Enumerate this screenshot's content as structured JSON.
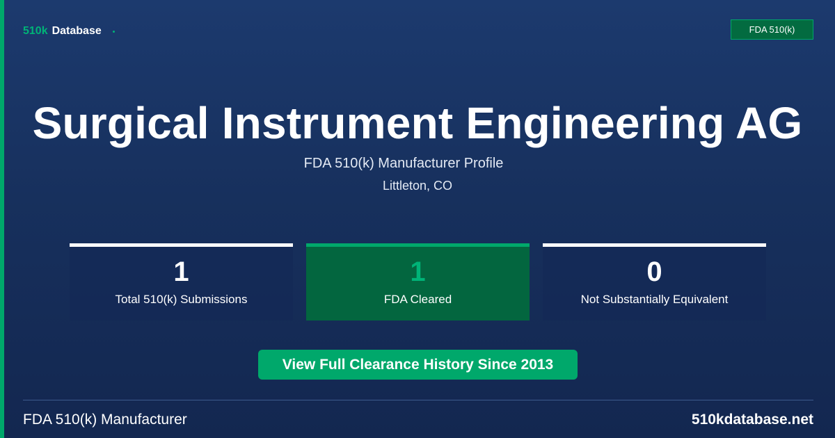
{
  "header": {
    "logo_prefix": "510k",
    "logo_suffix": "Database",
    "badge": "FDA 510(k)"
  },
  "main": {
    "title": "Surgical Instrument Engineering AG",
    "subtitle": "FDA 510(k) Manufacturer Profile",
    "location": "Littleton, CO"
  },
  "stats": [
    {
      "value": "1",
      "label": "Total 510(k) Submissions"
    },
    {
      "value": "1",
      "label": "FDA Cleared"
    },
    {
      "value": "0",
      "label": "Not Substantially Equivalent"
    }
  ],
  "cta": {
    "label": "View Full Clearance History Since 2013"
  },
  "footer": {
    "left": "FDA 510(k) Manufacturer",
    "right": "510kdatabase.net"
  },
  "colors": {
    "accent": "#00a86b",
    "background": "#1c3a6e",
    "highlight_card": "#03663f"
  }
}
